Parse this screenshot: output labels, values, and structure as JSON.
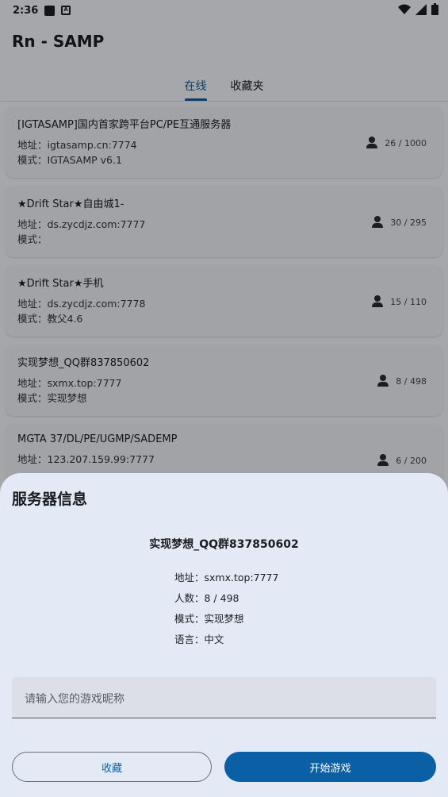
{
  "status": {
    "time": "2:36"
  },
  "app": {
    "title": "Rn - SAMP"
  },
  "tabs": [
    {
      "label": "在线"
    },
    {
      "label": "收藏夹"
    }
  ],
  "servers": [
    {
      "name": "[IGTASAMP]国内首家跨平台PC/PE互通服务器",
      "address": "地址：igtasamp.cn:7774",
      "mode": "模式：IGTASAMP v6.1",
      "players": "26 / 1000"
    },
    {
      "name": "★Drift Star★自由城1-",
      "address": "地址：ds.zycdjz.com:7777",
      "mode": "模式：",
      "players": "30 / 295"
    },
    {
      "name": "★Drift Star★手机",
      "address": "地址：ds.zycdjz.com:7778",
      "mode": "模式：教父4.6",
      "players": "15 / 110"
    },
    {
      "name": "实现梦想_QQ群837850602",
      "address": "地址：sxmx.top:7777",
      "mode": "模式：实现梦想",
      "players": "8 / 498"
    },
    {
      "name": "MGTA 37/DL/PE/UGMP/SADEMP",
      "address": "地址：123.207.159.99:7777",
      "mode": "",
      "players": "6 / 200"
    }
  ],
  "sheet": {
    "title": "服务器信息",
    "server_name": "实现梦想_QQ群837850602",
    "address": "地址：sxmx.top:7777",
    "players": "人数：8 / 498",
    "mode": "模式：实现梦想",
    "language": "语言：中文",
    "nickname_placeholder": "请输入您的游戏昵称",
    "fav_label": "收藏",
    "start_label": "开始游戏"
  },
  "colors": {
    "accent": "#0b5fa5",
    "sheet_bg": "#e3eaf6"
  }
}
